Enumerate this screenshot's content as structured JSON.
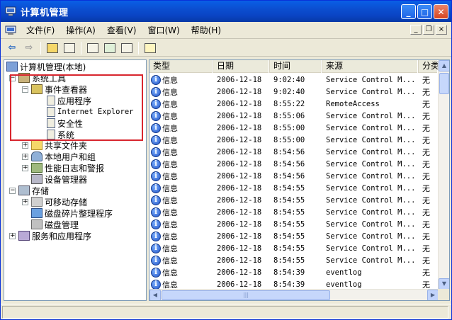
{
  "window": {
    "title": "计算机管理"
  },
  "menu": [
    "文件(F)",
    "操作(A)",
    "查看(V)",
    "窗口(W)",
    "帮助(H)"
  ],
  "mdi_buttons": [
    "_",
    "❐",
    "×"
  ],
  "tree": {
    "root": "计算机管理(本地)",
    "system_tools": "系统工具",
    "event_viewer": "事件查看器",
    "app_log": "应用程序",
    "ie_log": "Internet Explorer",
    "security_log": "安全性",
    "system_log": "系统",
    "shared_folders": "共享文件夹",
    "local_users": "本地用户和组",
    "perf_logs": "性能日志和警报",
    "device_manager": "设备管理器",
    "storage": "存储",
    "removable": "可移动存储",
    "defrag": "磁盘碎片整理程序",
    "disk_mgmt": "磁盘管理",
    "services": "服务和应用程序"
  },
  "table": {
    "headers": [
      "类型",
      "日期",
      "时间",
      "来源",
      "分类"
    ],
    "rows": [
      [
        "信息",
        "2006-12-18",
        "9:02:40",
        "Service Control M..."
      ],
      [
        "信息",
        "2006-12-18",
        "9:02:40",
        "Service Control M..."
      ],
      [
        "信息",
        "2006-12-18",
        "8:55:22",
        "RemoteAccess"
      ],
      [
        "信息",
        "2006-12-18",
        "8:55:06",
        "Service Control M..."
      ],
      [
        "信息",
        "2006-12-18",
        "8:55:00",
        "Service Control M..."
      ],
      [
        "信息",
        "2006-12-18",
        "8:55:00",
        "Service Control M..."
      ],
      [
        "信息",
        "2006-12-18",
        "8:54:56",
        "Service Control M..."
      ],
      [
        "信息",
        "2006-12-18",
        "8:54:56",
        "Service Control M..."
      ],
      [
        "信息",
        "2006-12-18",
        "8:54:56",
        "Service Control M..."
      ],
      [
        "信息",
        "2006-12-18",
        "8:54:55",
        "Service Control M..."
      ],
      [
        "信息",
        "2006-12-18",
        "8:54:55",
        "Service Control M..."
      ],
      [
        "信息",
        "2006-12-18",
        "8:54:55",
        "Service Control M..."
      ],
      [
        "信息",
        "2006-12-18",
        "8:54:55",
        "Service Control M..."
      ],
      [
        "信息",
        "2006-12-18",
        "8:54:55",
        "Service Control M..."
      ],
      [
        "信息",
        "2006-12-18",
        "8:54:55",
        "Service Control M..."
      ],
      [
        "信息",
        "2006-12-18",
        "8:54:55",
        "Service Control M..."
      ],
      [
        "信息",
        "2006-12-18",
        "8:54:39",
        "eventlog"
      ],
      [
        "信息",
        "2006-12-18",
        "8:54:39",
        "eventlog"
      ]
    ],
    "category": "无"
  },
  "colors": {
    "title_bar": "#0a5fe6",
    "highlight_box": "#d8262e",
    "info_icon": "#1f52c7"
  },
  "icons": [
    "computer-icon",
    "back-arrow-icon",
    "forward-arrow-icon",
    "up-folder-icon",
    "show-hide-tree-icon",
    "properties-icon",
    "refresh-icon",
    "export-list-icon",
    "help-icon"
  ]
}
